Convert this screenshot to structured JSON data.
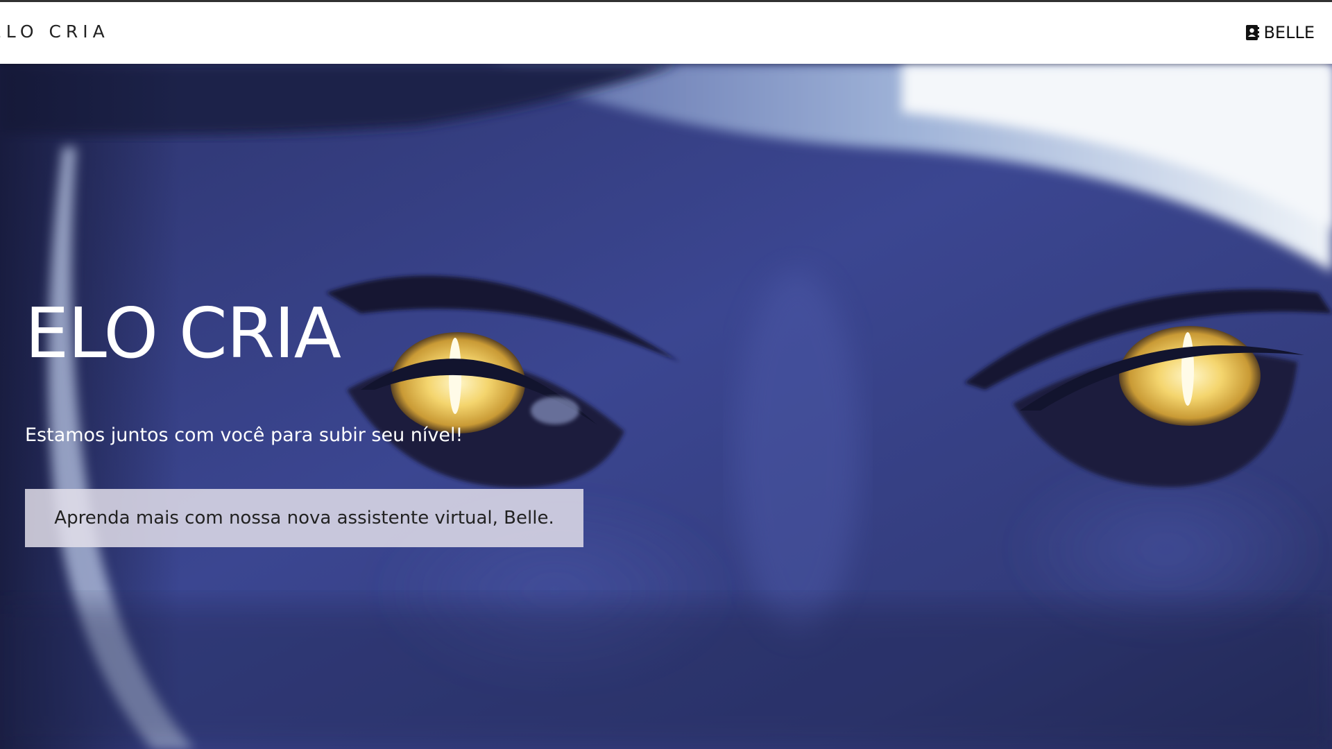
{
  "navbar": {
    "brand": "ELO CRIA",
    "assistant_link": "BELLE",
    "assistant_icon": "contact-book-icon"
  },
  "hero": {
    "title": "ELO CRIA",
    "subtitle": "Estamos juntos com você para subir seu nível!",
    "cta_label": "Aprenda mais com nossa nova assistente virtual, Belle.",
    "background_image": "close-up of blue-skinned face with glowing yellow cat eyes"
  },
  "colors": {
    "navbar_bg": "#ffffff",
    "hero_text": "#ffffff",
    "cta_bg": "#e4e0eb",
    "skin_blue": "#3a4590",
    "eye_yellow": "#f2d36a"
  }
}
